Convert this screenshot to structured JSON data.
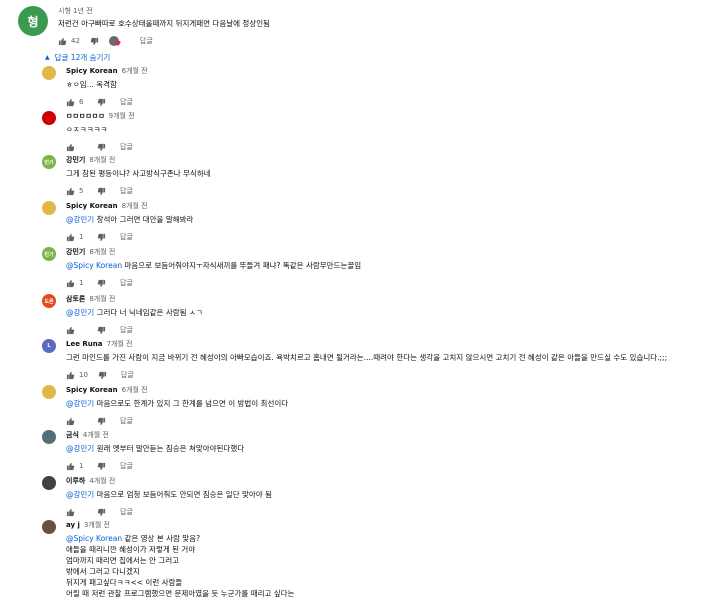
{
  "top_comment": {
    "avatar_letter": "형",
    "avatar_color": "#3a9a4f",
    "meta": "시형 1년 전",
    "text": "저런건 아구빠따로 호수상태올때까지 뒤지게패면 다음날에 정상인됨",
    "likes": "42",
    "reply_label": "답글"
  },
  "replies_toggle": {
    "label": "답글 12개 숨기기"
  },
  "replies": [
    {
      "author": "Spicy Korean",
      "time": "6개월 전",
      "avatar_color": "#e0b84a",
      "avatar_text": "",
      "lines": [
        {
          "mention": "",
          "text": "ㅎㅇ임... 옥격함"
        }
      ],
      "likes": "6",
      "reply_label": "답글"
    },
    {
      "author": "ㅁㅁㅁㅁㅁㅁ",
      "time": "9개월 전",
      "avatar_color": "#cc0000",
      "avatar_text": "",
      "lines": [
        {
          "mention": "",
          "text": "ㅇㅈㅋㅋㅋㅋ"
        }
      ],
      "likes": "",
      "reply_label": "답글"
    },
    {
      "author": "강민기",
      "time": "8개월 전",
      "avatar_color": "#7cb342",
      "avatar_text": "민기",
      "lines": [
        {
          "mention": "",
          "text": "그게 참된 평등이냐? 사고방식구존나 무식하네"
        }
      ],
      "likes": "5",
      "reply_label": "답글"
    },
    {
      "author": "Spicy Korean",
      "time": "8개월 전",
      "avatar_color": "#e0b84a",
      "avatar_text": "",
      "lines": [
        {
          "mention": "@강민기",
          "text": " 창석아 그러면 대안을 말해봐라"
        }
      ],
      "likes": "1",
      "reply_label": "답글"
    },
    {
      "author": "강민기",
      "time": "8개월 전",
      "avatar_color": "#7cb342",
      "avatar_text": "민기",
      "lines": [
        {
          "mention": "@Spicy Korean",
          "text": " 마음으로 보듬어줘야지ㅜ자식새끼를 뚜들겨 패냐? 똑같은 사람무만드는꼴임"
        }
      ],
      "likes": "1",
      "reply_label": "답글"
    },
    {
      "author": "삼토론",
      "time": "8개월 전",
      "avatar_color": "#e64a19",
      "avatar_text": "도론",
      "lines": [
        {
          "mention": "@강민기",
          "text": " 그러다 너 닉네임같은 사람됨 ㅅㄱ"
        }
      ],
      "likes": "",
      "reply_label": "답글"
    },
    {
      "author": "Lee Runa",
      "time": "7개월 전",
      "avatar_color": "#5c6bc0",
      "avatar_text": "L",
      "lines": [
        {
          "mention": "",
          "text": "그런 마인드를 가진 사람이 지금 바뀌기 전 혜성이의 아빠모습이죠. 욕박치르고 홈내면 될거라는....때려야 한다는 생각을 고치지 않으시면 고치기 전 혜성이 같은 아들을 만드실 수도 있습니다.;;;"
        }
      ],
      "likes": "10",
      "reply_label": "답글"
    },
    {
      "author": "Spicy Korean",
      "time": "6개월 전",
      "avatar_color": "#e0b84a",
      "avatar_text": "",
      "lines": [
        {
          "mention": "@강민기",
          "text": " 마음으로도 한계가 있지 그 한계를 넘으면 이 방법이 최선이다"
        }
      ],
      "likes": "",
      "reply_label": "답글"
    },
    {
      "author": "금식",
      "time": "4개월 전",
      "avatar_color": "#546e7a",
      "avatar_text": "",
      "lines": [
        {
          "mention": "@강민기",
          "text": " 원래 옛부터 말안듣는 짐승은 쳐맞아야된다했다"
        }
      ],
      "likes": "1",
      "reply_label": "답글"
    },
    {
      "author": "이루하",
      "time": "4개월 전",
      "avatar_color": "#424242",
      "avatar_text": "",
      "lines": [
        {
          "mention": "@강민기",
          "text": " 마음으로 엄청 보듬어줘도 안되면 짐승은 일단 맞아야 됨"
        }
      ],
      "likes": "",
      "reply_label": "답글"
    },
    {
      "author": "ay j",
      "time": "3개월 전",
      "avatar_color": "#6d4c41",
      "avatar_text": "",
      "lines": [
        {
          "mention": "@Spicy Korean",
          "text": " 같은 영상 본 사람 맞음?"
        },
        {
          "mention": "",
          "text": "애들을 때리니깐 혜성이가 저렇게 된 거야"
        },
        {
          "mention": "",
          "text": "엄마까지 때리면 집에서는 안 그러고"
        },
        {
          "mention": "",
          "text": "밖에서 그러고 다니겠지"
        },
        {
          "mention": "",
          "text": "뒤지게 패고싶다ㅋㅋ<< 이런 사람들"
        },
        {
          "mention": "",
          "text": "어릴 때 저런 관찰 프로그램했으면 문제아였을 듯 누군가를 때리고 싶다는"
        }
      ],
      "likes": "",
      "reply_label": ""
    }
  ]
}
